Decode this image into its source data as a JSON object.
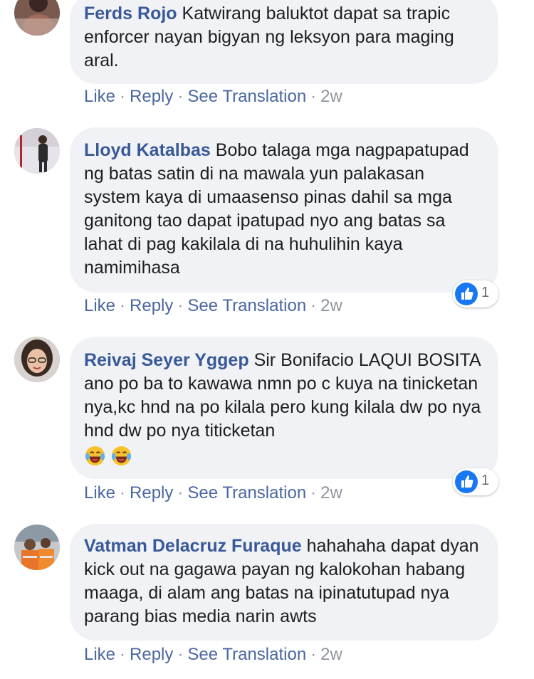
{
  "comments": [
    {
      "author": "Ferds Rojo",
      "text": "Katwirang baluktot dapat sa trapic enforcer nayan bigyan ng leksyon para maging aral.",
      "actions": {
        "like": "Like",
        "reply": "Reply",
        "translate": "See Translation",
        "time": "2w"
      }
    },
    {
      "author": "Lloyd Katalbas",
      "text": "Bobo talaga mga nagpapatupad ng batas satin di na mawala yun palakasan system kaya di umaasenso pinas dahil sa mga ganitong tao dapat ipatupad nyo ang batas sa lahat di pag kakilala di na huhulihin kaya namimihasa",
      "reaction_count": "1",
      "actions": {
        "like": "Like",
        "reply": "Reply",
        "translate": "See Translation",
        "time": "2w"
      }
    },
    {
      "author": "Reivaj Seyer Yggep",
      "text": "Sir Bonifacio LAQUI BOSITA ano po ba to kawawa nmn po c kuya na tinicketan nya,kc hnd na po kilala pero kung kilala dw po nya hnd dw po nya titicketan",
      "emojis": [
        "laughing-tears-icon",
        "laughing-tears-icon"
      ],
      "reaction_count": "1",
      "actions": {
        "like": "Like",
        "reply": "Reply",
        "translate": "See Translation",
        "time": "2w"
      }
    },
    {
      "author": "Vatman Delacruz Furaque",
      "text": "hahahaha dapat dyan kick out na gagawa payan ng kalokohan habang maaga, di alam ang batas na ipinatutupad nya parang bias media narin awts",
      "actions": {
        "like": "Like",
        "reply": "Reply",
        "translate": "See Translation",
        "time": "2w"
      }
    }
  ],
  "separator": "·",
  "colors": {
    "author": "#385898",
    "link": "#4b67a1",
    "bubble": "#f0f2f5",
    "like_blue": "#1877f2",
    "meta": "#90949c"
  }
}
